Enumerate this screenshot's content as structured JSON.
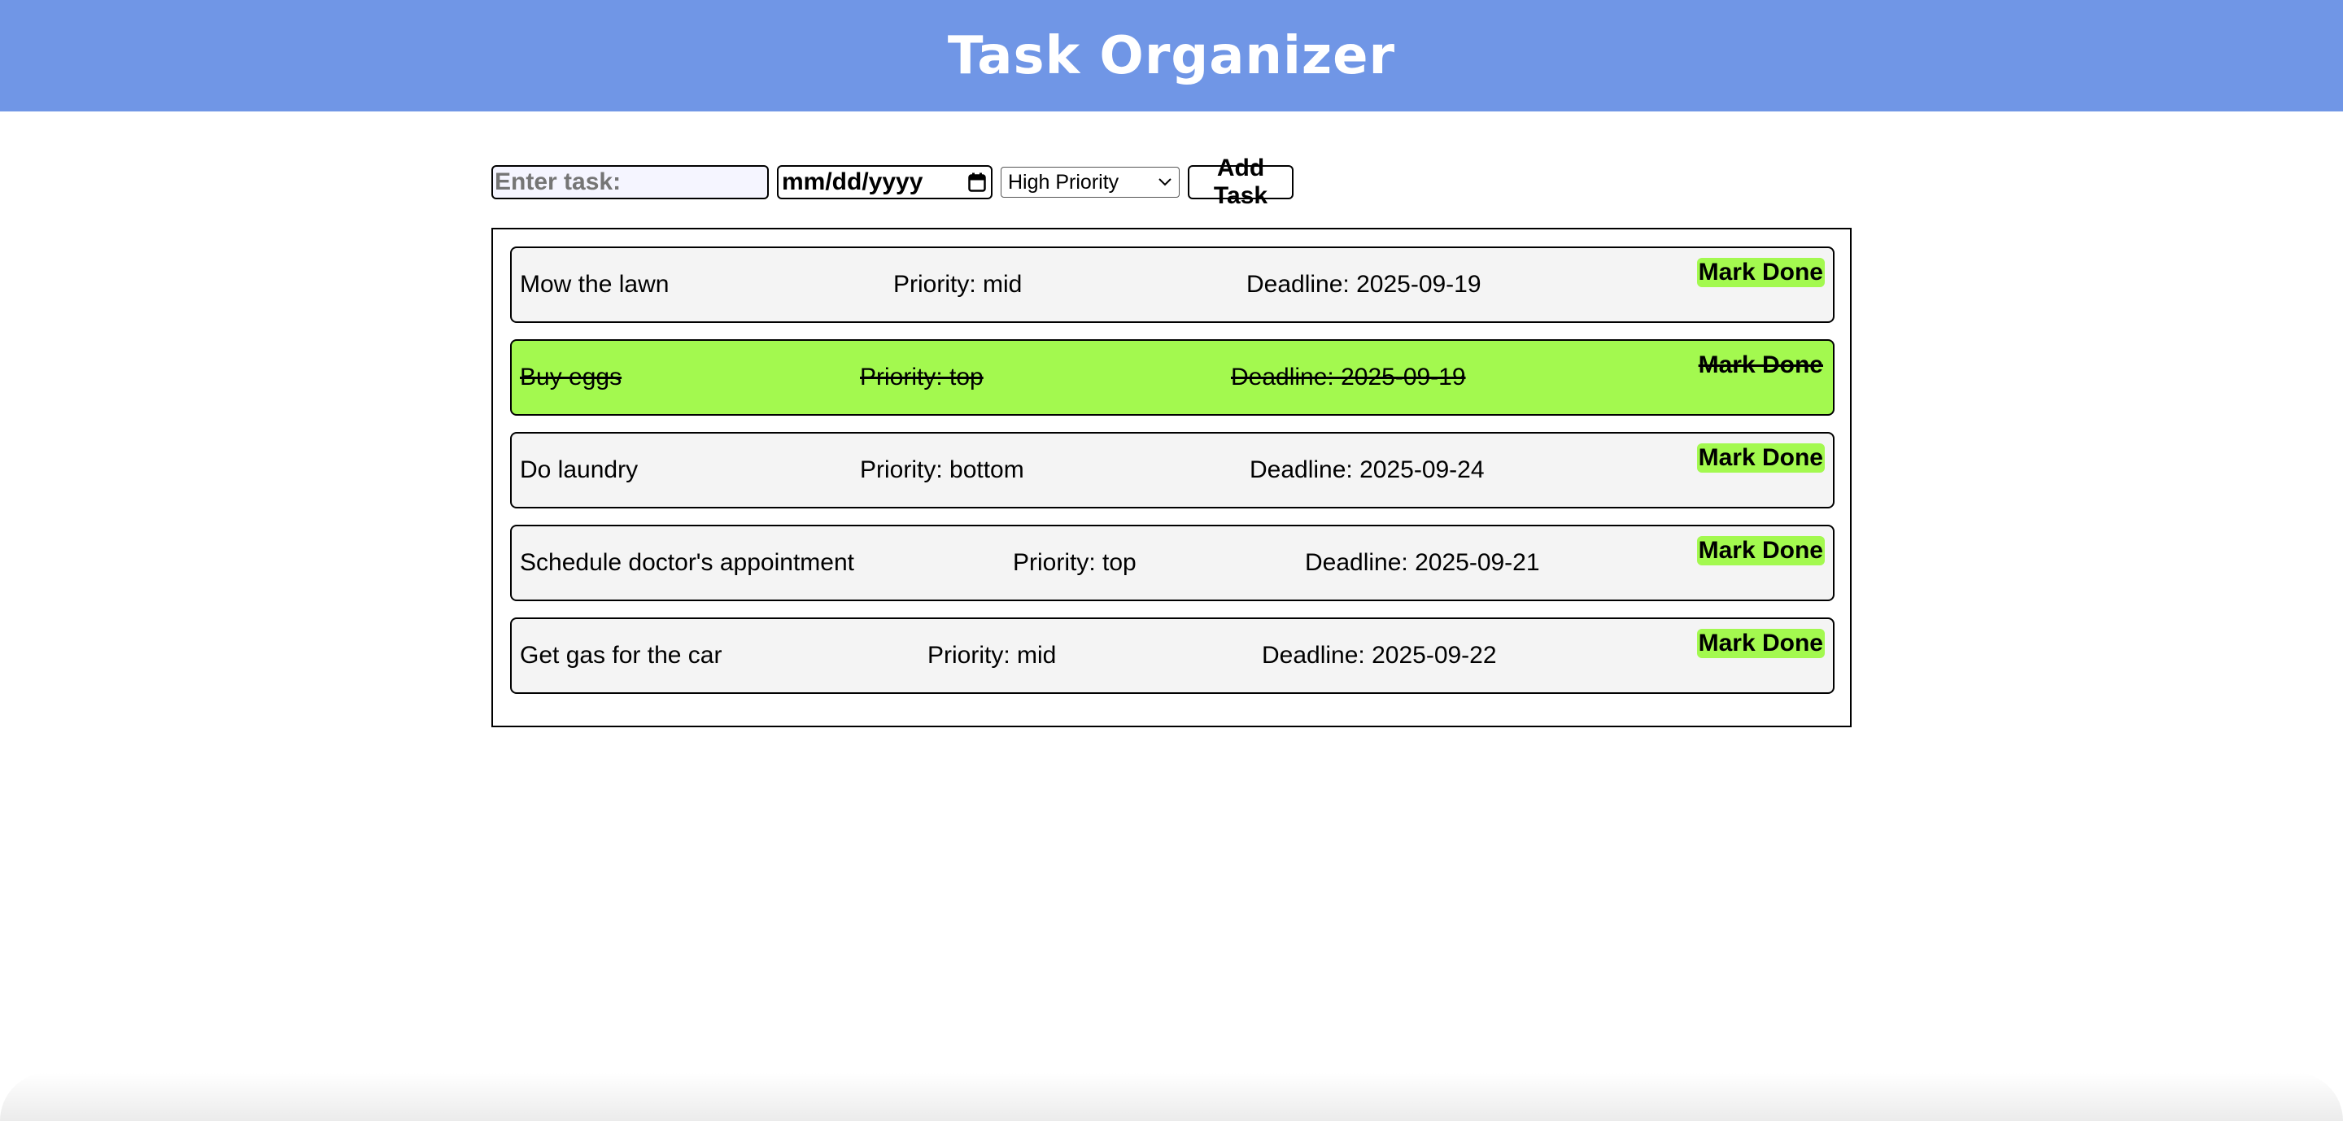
{
  "header": {
    "title": "Task Organizer"
  },
  "form": {
    "task_placeholder": "Enter task:",
    "date_placeholder": "mm/dd/yyyy",
    "priority_selected": "High Priority",
    "add_label": "Add Task"
  },
  "tasks": [
    {
      "name": "Mow the lawn",
      "priority": "Priority: mid",
      "deadline": "Deadline: 2025-09-19",
      "action": "Mark Done",
      "done": false
    },
    {
      "name": "Buy eggs",
      "priority": "Priority: top",
      "deadline": "Deadline: 2025-09-19",
      "action": "Mark Done",
      "done": true
    },
    {
      "name": "Do laundry",
      "priority": "Priority: bottom",
      "deadline": "Deadline: 2025-09-24",
      "action": "Mark Done",
      "done": false
    },
    {
      "name": "Schedule doctor's appointment",
      "priority": "Priority: top",
      "deadline": "Deadline: 2025-09-21",
      "action": "Mark Done",
      "done": false
    },
    {
      "name": "Get gas for the car",
      "priority": "Priority: mid",
      "deadline": "Deadline: 2025-09-22",
      "action": "Mark Done",
      "done": false
    }
  ],
  "colors": {
    "header": "#7096e6",
    "done_row": "#a3f94f",
    "row": "#f4f4f4"
  }
}
